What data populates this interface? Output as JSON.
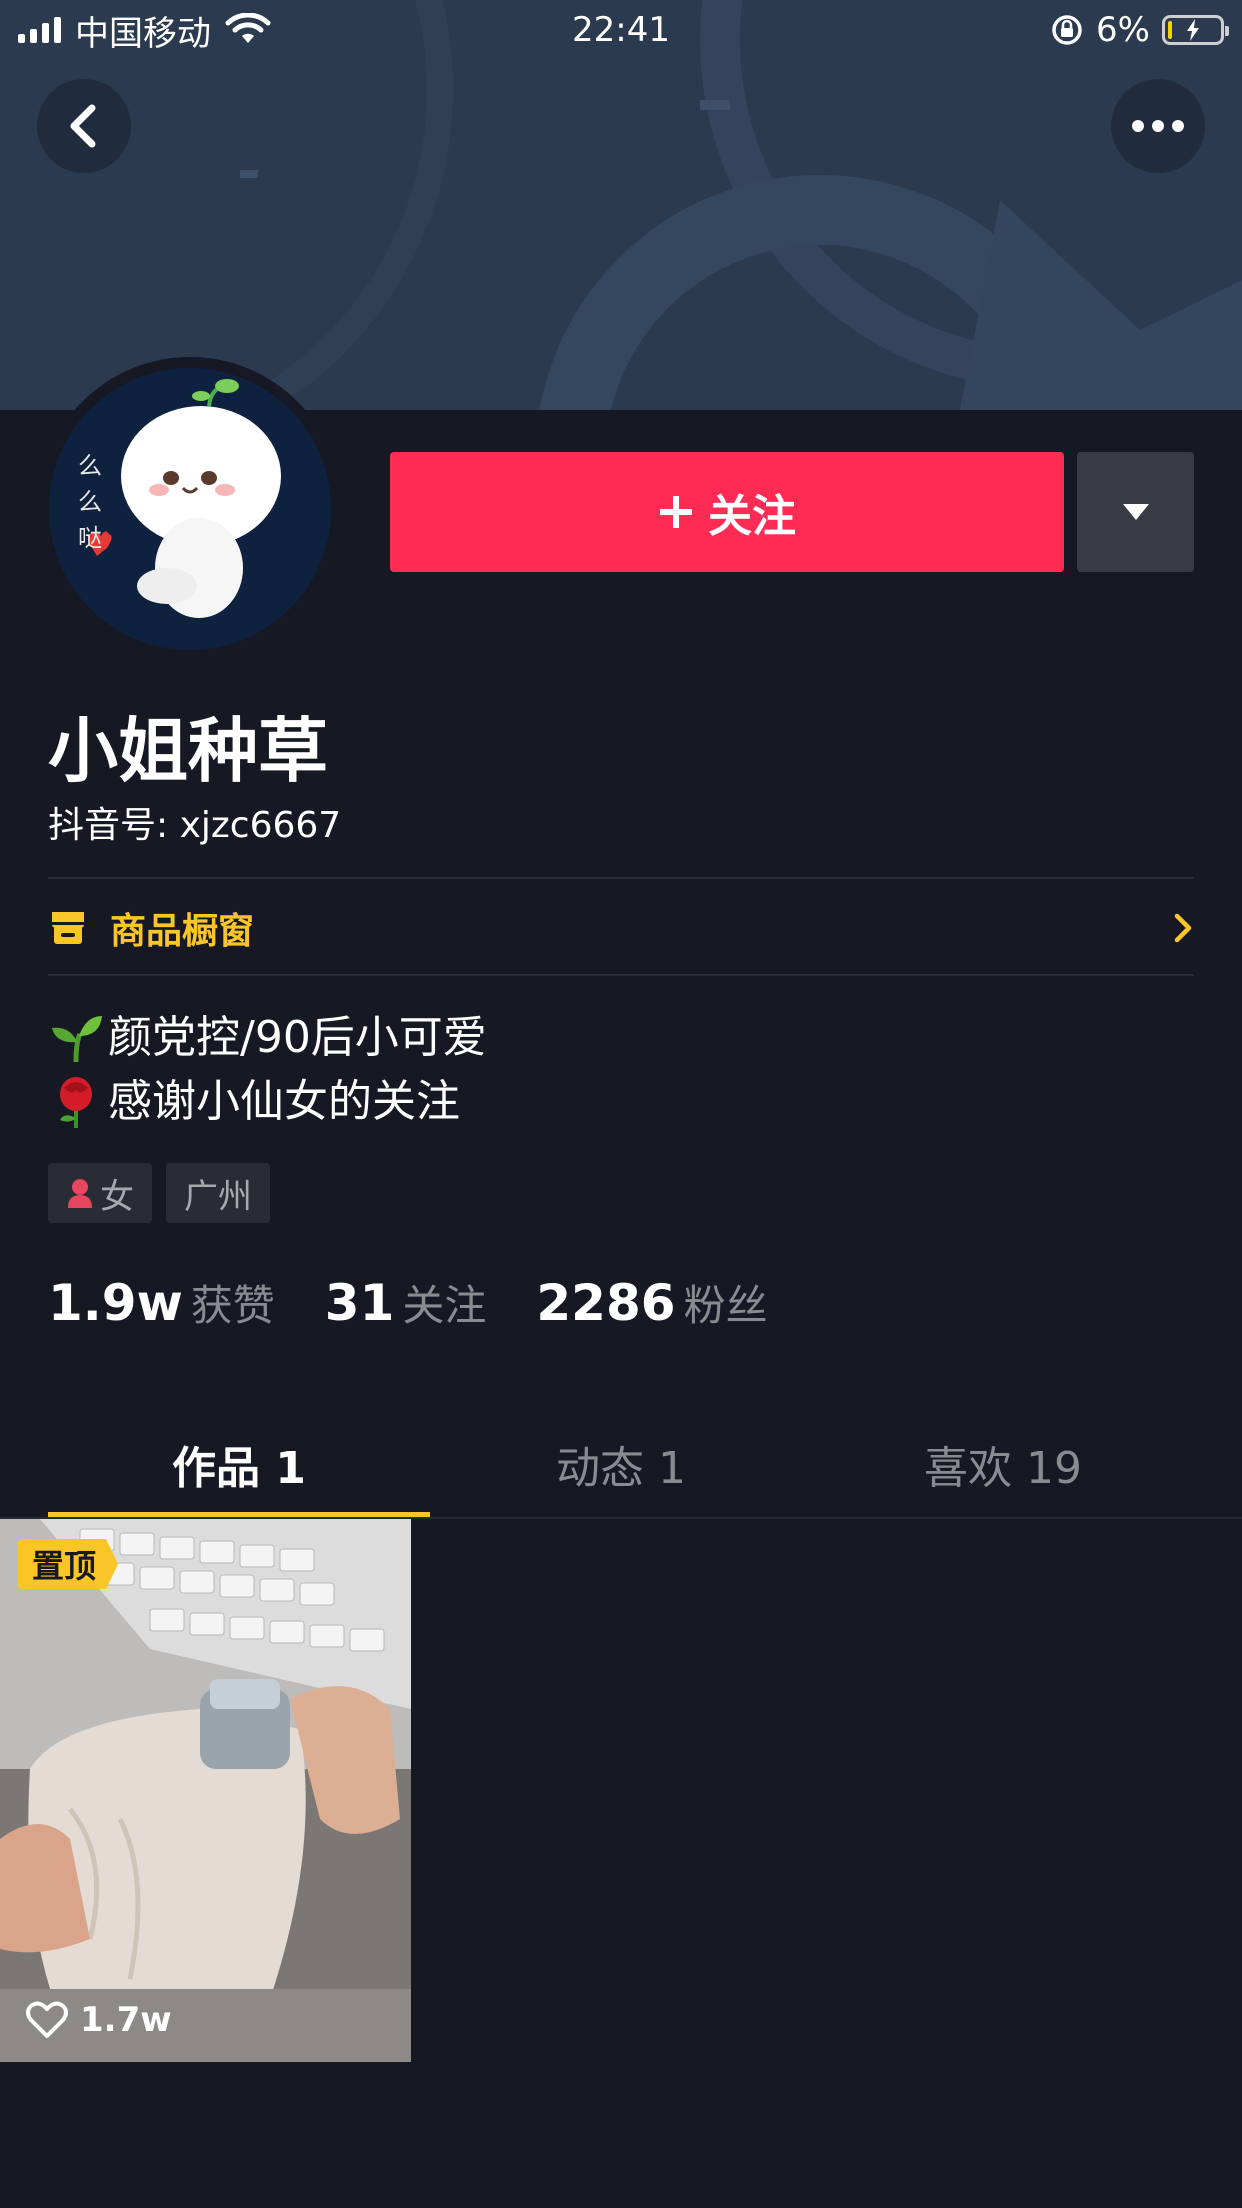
{
  "status_bar": {
    "carrier": "中国移动",
    "time": "22:41",
    "battery_percent": "6%",
    "battery_level": 0.06,
    "icons": [
      "signal-icon",
      "wifi-icon",
      "rotation-lock-icon",
      "battery-charging-icon"
    ]
  },
  "nav": {
    "back_icon": "chevron-left-icon",
    "more_icon": "more-dots-icon"
  },
  "profile": {
    "nickname": "小姐种草",
    "douyin_id": "抖音号: xjzc6667",
    "avatar_text": "么么哒"
  },
  "actions": {
    "follow_label": "关注",
    "follow_icon": "plus-icon",
    "dropdown_icon": "caret-down-icon"
  },
  "shop": {
    "label": "商品橱窗",
    "icon": "shop-icon",
    "arrow_icon": "chevron-right-icon"
  },
  "bio": {
    "line1": "颜党控/90后小可爱",
    "line1_emoji": "seedling-emoji",
    "line2": "感谢小仙女的关注",
    "line2_emoji": "rose-emoji"
  },
  "tags": [
    {
      "label": "女",
      "icon": "female-user-icon"
    },
    {
      "label": "广州"
    }
  ],
  "stats": [
    {
      "value": "1.9w",
      "label": "获赞"
    },
    {
      "value": "31",
      "label": "关注"
    },
    {
      "value": "2286",
      "label": "粉丝"
    }
  ],
  "tabs": [
    {
      "label": "作品 1",
      "active": true
    },
    {
      "label": "动态 1",
      "active": false
    },
    {
      "label": "喜欢 19",
      "active": false
    }
  ],
  "videos": [
    {
      "pinned_label": "置顶",
      "likes": "1.7w",
      "like_icon": "heart-outline-icon"
    }
  ],
  "colors": {
    "background": "#161823",
    "accent_red": "#fe2c55",
    "accent_yellow": "#fac526",
    "banner": "#2b3a4f"
  }
}
